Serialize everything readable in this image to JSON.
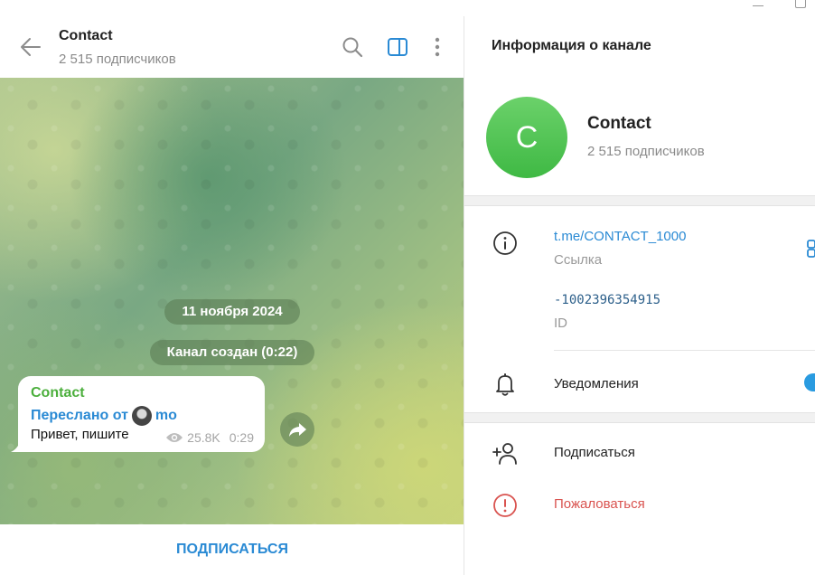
{
  "chat": {
    "title": "Contact",
    "subtitle": "2 515 подписчиков",
    "date_pill": "11 ноября 2024",
    "service_pill": "Канал создан (0:22)",
    "message": {
      "author": "Contact",
      "forwarded_prefix": "Переслано от",
      "forwarded_from": "mo",
      "text": "Привет, пишите",
      "views": "25.8K",
      "time": "0:29"
    },
    "subscribe_label": "ПОДПИСАТЬСЯ"
  },
  "info": {
    "title": "Информация о канале",
    "avatar_letter": "C",
    "name": "Contact",
    "subscribers": "2 515 подписчиков",
    "link": "t.me/CONTACT_1000",
    "link_label": "Ссылка",
    "id_value": "-1002396354915",
    "id_label": "ID",
    "notifications_label": "Уведомления",
    "notifications_on": true,
    "subscribe_label": "Подписаться",
    "report_label": "Пожаловаться"
  },
  "colors": {
    "accent": "#2a8ad4",
    "author": "#4caf3d",
    "danger": "#d9534f",
    "avatar": "#4cc04a"
  },
  "icons": [
    "back-arrow-icon",
    "search-icon",
    "sidebar-toggle-icon",
    "more-vertical-icon",
    "eye-icon",
    "share-icon",
    "info-icon",
    "qr-code-icon",
    "bell-icon",
    "add-user-icon",
    "warning-icon"
  ]
}
